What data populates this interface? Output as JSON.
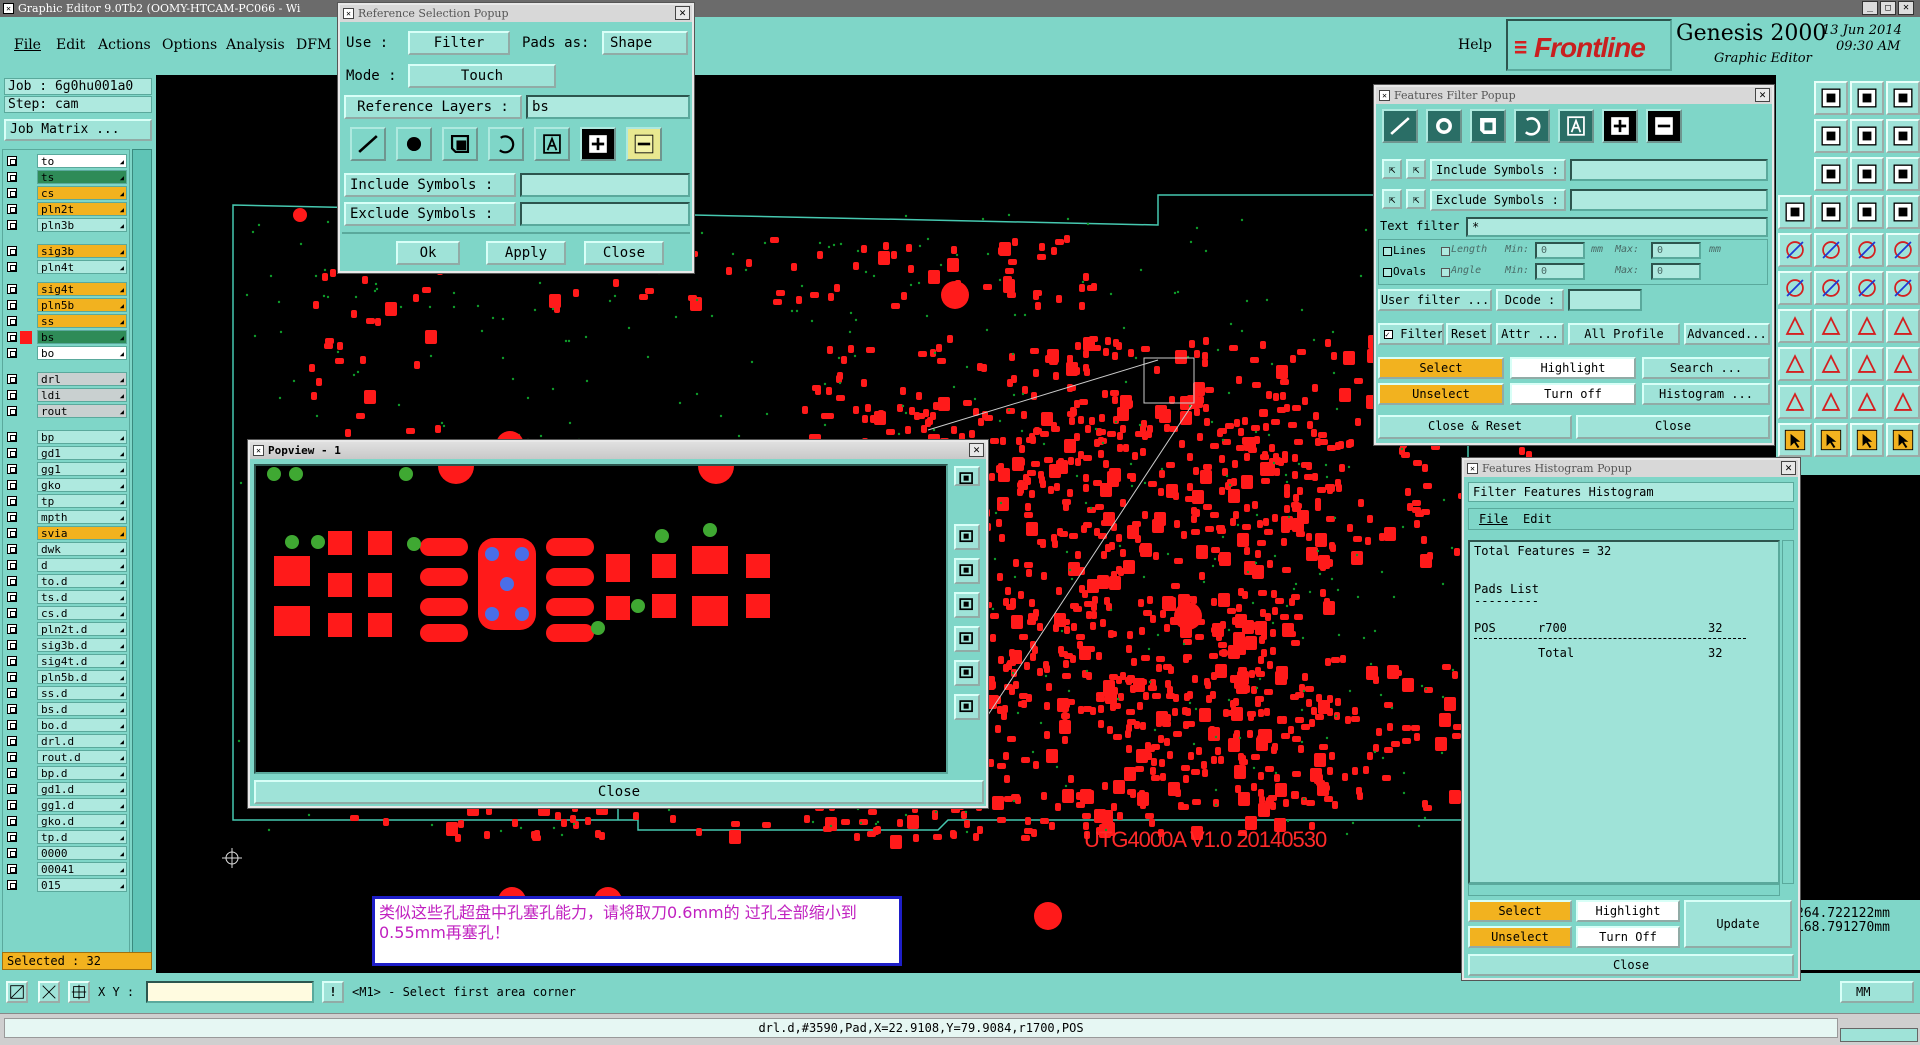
{
  "app": {
    "title": "Graphic Editor 9.0Tb2 (OOMY-HTCAM-PC066 - Wi",
    "product": "Genesis 2000",
    "subtitle": "Graphic Editor",
    "brand": "Frontline",
    "date": "13 Jun 2014",
    "time": "09:30 AM"
  },
  "menu": {
    "file": "File",
    "edit": "Edit",
    "actions": "Actions",
    "options": "Options",
    "analysis": "Analysis",
    "dfm": "DFM",
    "help": "Help"
  },
  "job": {
    "job": "Job : 6g0hu001a0",
    "step": "Step: cam",
    "matrix": "Job Matrix ..."
  },
  "layers": [
    {
      "name": "to",
      "color": "#ffffff"
    },
    {
      "name": "ts",
      "color": "#2e8b57"
    },
    {
      "name": "cs",
      "color": "#f2b21f"
    },
    {
      "name": "pln2t",
      "color": "#f2b21f"
    },
    {
      "name": "pln3b",
      "color": "#aee9df"
    },
    {
      "name": "sig3b",
      "color": "#f2b21f"
    },
    {
      "name": "pln4t",
      "color": "#aee9df"
    },
    {
      "name": "sig4t",
      "color": "#f2b21f"
    },
    {
      "name": "pln5b",
      "color": "#f2b21f"
    },
    {
      "name": "ss",
      "color": "#f2b21f"
    },
    {
      "name": "bs",
      "color": "#2e8b57"
    },
    {
      "name": "bo",
      "color": "#ffffff"
    },
    {
      "name": "drl",
      "color": "#c9d0d0"
    },
    {
      "name": "ldi",
      "color": "#c9d0d0"
    },
    {
      "name": "rout",
      "color": "#c9d0d0"
    },
    {
      "name": "bp",
      "color": "#aee9df"
    },
    {
      "name": "gd1",
      "color": "#aee9df"
    },
    {
      "name": "gg1",
      "color": "#aee9df"
    },
    {
      "name": "gko",
      "color": "#aee9df"
    },
    {
      "name": "tp",
      "color": "#aee9df"
    },
    {
      "name": "mpth",
      "color": "#aee9df"
    },
    {
      "name": "svia",
      "color": "#f2b21f"
    },
    {
      "name": "dwk",
      "color": "#aee9df"
    },
    {
      "name": "d",
      "color": "#aee9df"
    },
    {
      "name": "to.d",
      "color": "#aee9df"
    },
    {
      "name": "ts.d",
      "color": "#aee9df"
    },
    {
      "name": "cs.d",
      "color": "#aee9df"
    },
    {
      "name": "pln2t.d",
      "color": "#aee9df"
    },
    {
      "name": "sig3b.d",
      "color": "#aee9df"
    },
    {
      "name": "sig4t.d",
      "color": "#aee9df"
    },
    {
      "name": "pln5b.d",
      "color": "#aee9df"
    },
    {
      "name": "ss.d",
      "color": "#aee9df"
    },
    {
      "name": "bs.d",
      "color": "#aee9df"
    },
    {
      "name": "bo.d",
      "color": "#aee9df"
    },
    {
      "name": "drl.d",
      "color": "#aee9df"
    },
    {
      "name": "rout.d",
      "color": "#aee9df"
    },
    {
      "name": "bp.d",
      "color": "#aee9df"
    },
    {
      "name": "gd1.d",
      "color": "#aee9df"
    },
    {
      "name": "gg1.d",
      "color": "#aee9df"
    },
    {
      "name": "gko.d",
      "color": "#aee9df"
    },
    {
      "name": "tp.d",
      "color": "#aee9df"
    },
    {
      "name": "0000",
      "color": "#aee9df"
    },
    {
      "name": "00041",
      "color": "#aee9df"
    },
    {
      "name": "015",
      "color": "#aee9df"
    }
  ],
  "selected": "Selected : 32",
  "refpopup": {
    "title": "Reference Selection Popup",
    "use_label": "Use  :",
    "use_value": "Filter",
    "pads_label": "Pads as:",
    "pads_value": "Shape",
    "mode_label": "Mode  :",
    "mode_value": "Touch",
    "reflayers_label": "Reference Layers :",
    "reflayers_value": "bs",
    "include_label": "Include Symbols  :",
    "exclude_label": "Exclude Symbols  :",
    "ok": "Ok",
    "apply": "Apply",
    "close": "Close"
  },
  "popview": {
    "title": "Popview - 1",
    "close": "Close"
  },
  "filterpopup": {
    "title": "Features Filter Popup",
    "include_label": "Include Symbols :",
    "exclude_label": "Exclude Symbols :",
    "textfilter_label": "Text filter",
    "textfilter_value": "*",
    "lines": "Lines",
    "ovals": "Ovals",
    "length": "Length",
    "angle": "Angle",
    "min": "Min:",
    "max": "Max:",
    "zero": "0",
    "mm": "mm",
    "userfilter": "User filter ...",
    "dcode": "Dcode :",
    "filter": "Filter",
    "reset": "Reset",
    "attr": "Attr ...",
    "allprofile": "All Profile",
    "advanced": "Advanced...",
    "select": "Select",
    "highlight": "Highlight",
    "search": "Search ...",
    "unselect": "Unselect",
    "turnoff": "Turn off",
    "histogram": "Histogram ...",
    "closereset": "Close & Reset",
    "close": "Close"
  },
  "histpopup": {
    "title": "Features Histogram Popup",
    "heading": "Filter Features Histogram",
    "file": "File",
    "edit": "Edit",
    "total_features": "Total Features = 32",
    "pads_list": "Pads List",
    "dashes": "---------",
    "row_pos": "POS",
    "row_sym": "r700",
    "row_count": "32",
    "total_label": "Total",
    "total_count": "32",
    "select": "Select",
    "highlight": "Highlight",
    "update": "Update",
    "unselect": "Unselect",
    "turnoff": "Turn Off",
    "close": "Close"
  },
  "board_text": "UTG4000A V1.0  20140530",
  "note": "类似这些孔超盘中孔塞孔能力，请将取刀0.6mm的 过孔全部缩小到0.55mm再塞孔！",
  "coords": {
    "x": "264.722122mm",
    "y": "168.791270mm"
  },
  "units": "MM",
  "cmdbar": {
    "xy_label": "X Y :",
    "prompt": "<M1> - Select first area corner"
  },
  "status": "drl.d,#3590,Pad,X=22.9108,Y=79.9084,r1700,POS"
}
